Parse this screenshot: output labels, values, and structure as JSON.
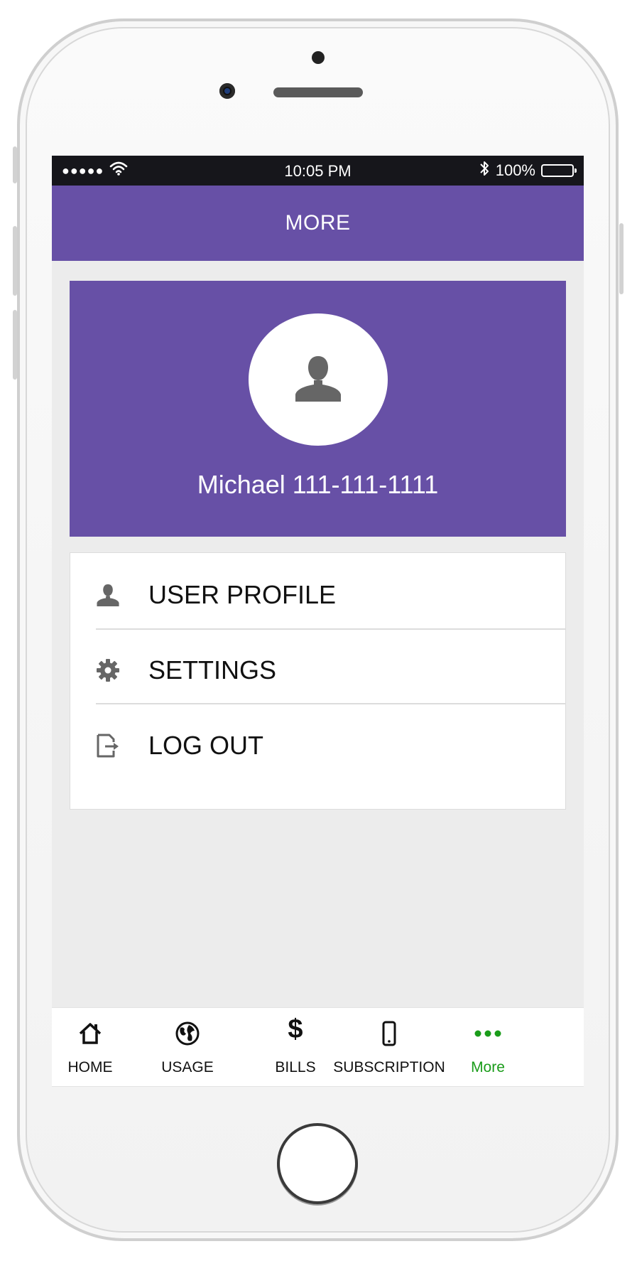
{
  "status_bar": {
    "time": "10:05 PM",
    "battery_percent": "100%",
    "signal_dots": "●●●●●"
  },
  "header": {
    "title": "MORE"
  },
  "profile": {
    "name_line": "Michael 111-111-1111",
    "avatar_icon": "person-icon"
  },
  "menu": {
    "items": [
      {
        "label": "USER PROFILE",
        "icon": "person-icon"
      },
      {
        "label": "SETTINGS",
        "icon": "gear-icon"
      },
      {
        "label": "LOG OUT",
        "icon": "logout-icon"
      }
    ]
  },
  "tabbar": {
    "active_color": "#1a9c1a",
    "tabs": [
      {
        "label": "HOME",
        "icon": "home-icon"
      },
      {
        "label": "USAGE",
        "icon": "globe-icon"
      },
      {
        "label": "BILLS",
        "icon": "dollar-icon"
      },
      {
        "label": "SUBSCRIPTION",
        "icon": "phone-icon"
      },
      {
        "label": "More",
        "icon": "more-dots-icon",
        "active": true
      }
    ]
  },
  "colors": {
    "brand_purple": "#6750a6",
    "status_bar": "#16161b",
    "background": "#ececec"
  }
}
